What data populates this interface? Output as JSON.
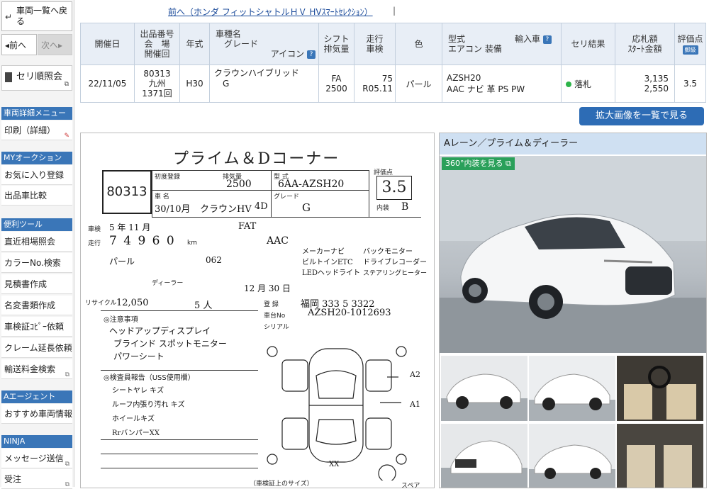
{
  "sidebar": {
    "back_label": "車両一覧へ戻る",
    "prev_label": "◂前へ",
    "next_label": "次へ▸",
    "order_label": "セリ順照会",
    "sections": [
      {
        "title": "車両詳細メニュー",
        "items": [
          "印刷（詳細）"
        ]
      },
      {
        "title": "MYオークション",
        "items": [
          "お気に入り登録",
          "出品車比較"
        ]
      },
      {
        "title": "便利ツール",
        "items": [
          "直近相場照会",
          "カラーNo.検索",
          "見積書作成",
          "名変書類作成",
          "車検証ｺﾋﾟｰ依頼",
          "クレーム延長依頼",
          "輸送料金検索"
        ]
      },
      {
        "title": "Aエージェント",
        "items": [
          "おすすめ車両情報"
        ]
      },
      {
        "title": "NINJA",
        "items": [
          "メッセージ送信",
          "受注"
        ]
      }
    ]
  },
  "top": {
    "prev_link": "前へ（ホンダ フィットシャトルＨＶ HVｽﾏｰﾄｾﾚｸｼｮﾝ）",
    "separator": "|"
  },
  "table": {
    "headers": {
      "date": "開催日",
      "lot_l1": "出品番号",
      "lot_l2": "会　場",
      "lot_l3": "開催回",
      "year": "年式",
      "model_l1": "車種名",
      "model_l2": "グレード",
      "model_l3": "アイコン",
      "shift_l1": "シフト",
      "shift_l2": "排気量",
      "mileage_l1": "走行",
      "mileage_l2": "車検",
      "color": "色",
      "type_l1": "型式",
      "type_import": "輸入車",
      "type_l2": "エアコン 装備",
      "result": "セリ結果",
      "price_l1": "応札額",
      "price_l2": "ｽﾀｰﾄ金額",
      "score_l1": "評価点",
      "score_badge": "郵級"
    },
    "row": {
      "date": "22/11/05",
      "lot": "80313",
      "venue": "九州",
      "session": "1371回",
      "year": "H30",
      "model": "クラウンハイブリッド",
      "grade": "G",
      "shift": "FA",
      "displacement": "2500",
      "mileage": "75",
      "inspection": "R05.11",
      "color": "パール",
      "type": "AZSH20",
      "equipment": "AAC ナビ 革 PS PW",
      "result": "落札",
      "bid": "3,135",
      "start": "2,550",
      "score": "3.5"
    }
  },
  "enlarge_button": "拡大画像を一覧で見る",
  "sheet": {
    "title": "プライム＆Dコーナー",
    "lot": "80313",
    "displacement": "2500",
    "model_code": "6AA-AZSH20",
    "score": "3.5",
    "score_label": "評価点",
    "interior_label": "内装",
    "interior": "B",
    "first_reg": "30/10月",
    "car_name": "クラウンHV",
    "doors": "4D",
    "grade": "G",
    "shaken_label": "車検",
    "shaken": "5 年 11 月",
    "mileage_label": "走行",
    "mileage": "7 4 9 6 0",
    "mileage_unit": "km",
    "shift": "FAT",
    "ac": "AAC",
    "color_l": "パール",
    "color_code": "062",
    "recycle_label": "リサイクル",
    "recycle": "12,050",
    "seats": "5 人",
    "sales_points": [
      "メーカーナビ",
      "バックモニター",
      "ビルトインETC",
      "ドライブレコーダー",
      "LEDヘッドライト",
      "ステアリングヒーター"
    ],
    "notes_label": "◎注意事項",
    "notes": [
      "ヘッドアップディスプレイ",
      "ブラインド スポットモニター",
      "パワーシート"
    ],
    "inspection_label": "◎検査員報告（USS使用欄）",
    "inspector_notes": [
      "シートヤレ キズ",
      "ルーフ内張り汚れ キズ",
      "ホイールキズ",
      "RrバンパーXX"
    ],
    "reg_no": "福岡 333 5 3322",
    "chassis": "AZSH20-1012693",
    "reg_label": "登 録",
    "chassis_label": "車台No",
    "serial_label": "シリアル",
    "dealer": "ディーラー",
    "first_reg_label": "初度登録",
    "displacement_label": "排気量",
    "type_label": "型 式",
    "name_label": "車 名",
    "grade_label": "グレード",
    "date_end": "12 月 30 日",
    "mark_a1": "A1",
    "mark_a2": "A2",
    "mark_xx": "XX",
    "spare_label": "スペア",
    "size_label": "（車検証上のサイズ）"
  },
  "photos": {
    "header": "Aレーン／プライム＆ディーラー",
    "view360": "360°内装を見る"
  }
}
